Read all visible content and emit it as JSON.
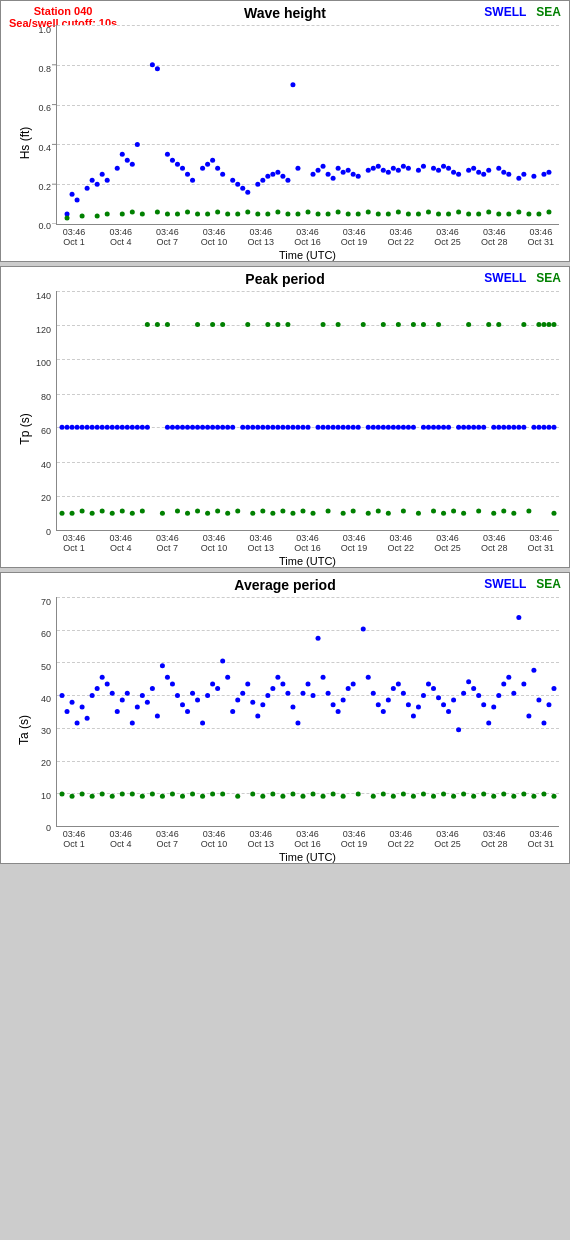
{
  "charts": [
    {
      "id": "wave-height",
      "station": "Station 040",
      "cutoff": "Sea/swell cutoff: 10s",
      "title": "Wave height",
      "y_label": "Hs (ft)",
      "y_ticks": [
        "1.0",
        "0.8",
        "0.6",
        "0.4",
        "0.2",
        "0.0"
      ],
      "legend_swell": "SWELL",
      "legend_sea": "SEA",
      "x_ticks": [
        "03:46\nOct 1",
        "03:46\nOct 4",
        "03:46\nOct 7",
        "03:46\nOct 10",
        "03:46\nOct 13",
        "03:46\nOct 16",
        "03:46\nOct 19",
        "03:46\nOct 22",
        "03:46\nOct 25",
        "03:46\nOct 28",
        "03:46\nOct 31"
      ],
      "x_axis_title": "Time (UTC)"
    },
    {
      "id": "peak-period",
      "title": "Peak period",
      "y_label": "Tp (s)",
      "y_ticks": [
        "140",
        "120",
        "100",
        "80",
        "60",
        "40",
        "20",
        "0"
      ],
      "legend_swell": "SWELL",
      "legend_sea": "SEA",
      "x_ticks": [
        "03:46\nOct 1",
        "03:46\nOct 4",
        "03:46\nOct 7",
        "03:46\nOct 10",
        "03:46\nOct 13",
        "03:46\nOct 16",
        "03:46\nOct 19",
        "03:46\nOct 22",
        "03:46\nOct 25",
        "03:46\nOct 28",
        "03:46\nOct 31"
      ],
      "x_axis_title": "Time (UTC)"
    },
    {
      "id": "avg-period",
      "title": "Average period",
      "y_label": "Ta (s)",
      "y_ticks": [
        "70",
        "60",
        "50",
        "40",
        "30",
        "20",
        "10",
        "0"
      ],
      "legend_swell": "SWELL",
      "legend_sea": "SEA",
      "x_ticks": [
        "03:46\nOct 1",
        "03:46\nOct 4",
        "03:46\nOct 7",
        "03:46\nOct 10",
        "03:46\nOct 13",
        "03:46\nOct 16",
        "03:46\nOct 19",
        "03:46\nOct 22",
        "03:46\nOct 25",
        "03:46\nOct 28",
        "03:46\nOct 31"
      ],
      "x_axis_title": "Time (UTC)"
    }
  ]
}
